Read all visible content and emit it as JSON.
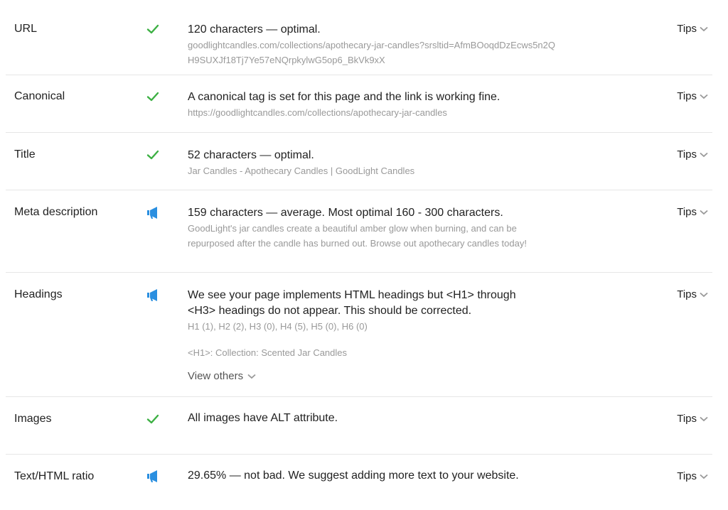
{
  "tips_label": "Tips",
  "colors": {
    "ok": "#3cb043",
    "info": "#2a8fe0",
    "muted": "#999999"
  },
  "rows": [
    {
      "label": "URL",
      "status_icon": "check-icon",
      "main": "120 characters — optimal.",
      "sub": "goodlightcandles.com/collections/apothecary-jar-candles?srsltid=AfmBOoqdDzEcws5n2QH9SUXJf18Tj7Ye57eNQrpkylwG5op6_BkVk9xX"
    },
    {
      "label": "Canonical",
      "status_icon": "check-icon",
      "main": "A canonical tag is set for this page and the link is working fine.",
      "sub": "https://goodlightcandles.com/collections/apothecary-jar-candles"
    },
    {
      "label": "Title",
      "status_icon": "check-icon",
      "main": "52 characters — optimal.",
      "sub": "Jar Candles - Apothecary Candles | GoodLight Candles"
    },
    {
      "label": "Meta description",
      "status_icon": "megaphone-icon",
      "main": "159 characters — average. Most optimal 160 - 300 characters.",
      "sub": "GoodLight's jar candles create a beautiful amber glow when burning, and can be repurposed after the candle has burned out. Browse out apothecary candles today!"
    },
    {
      "label": "Headings",
      "status_icon": "megaphone-icon",
      "main": "We see your page implements HTML headings but <H1> through <H3> headings do not appear. This should be corrected.",
      "sub": "H1 (1), H2 (2), H3 (0), H4 (5), H5 (0), H6 (0)",
      "h1_line": "<H1>: Collection: Scented Jar Candles",
      "view_others": "View others"
    },
    {
      "label": "Images",
      "status_icon": "check-icon",
      "main": "All images have ALT attribute."
    },
    {
      "label": "Text/HTML ratio",
      "status_icon": "megaphone-icon",
      "main": "29.65% — not bad. We suggest adding more text to your website."
    }
  ]
}
